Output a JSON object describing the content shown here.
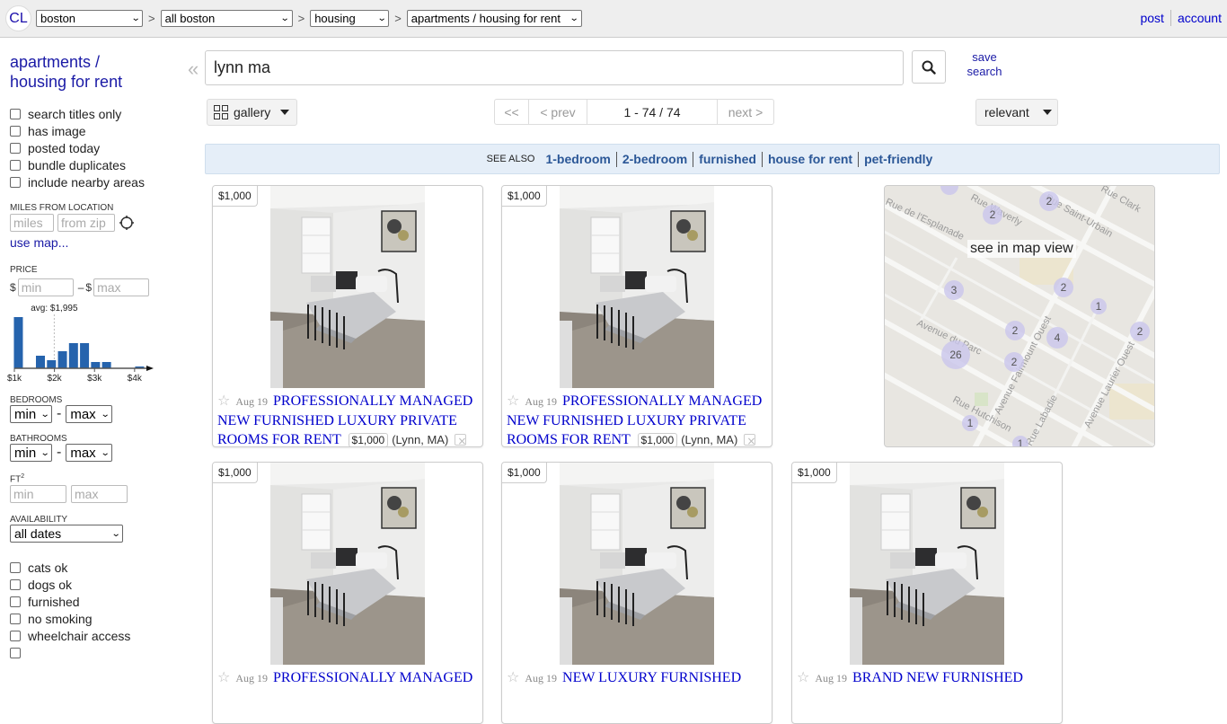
{
  "header": {
    "logo": "CL",
    "breadcrumbs": [
      {
        "label": "boston"
      },
      {
        "label": "all boston"
      },
      {
        "label": "housing"
      },
      {
        "label": "apartments / housing for rent"
      }
    ],
    "breadcrumb_separator": ">",
    "links": {
      "post": "post",
      "account": "account"
    }
  },
  "sidebar": {
    "title_line1": "apartments /",
    "title_line2": "housing for rent",
    "top_filters": [
      {
        "label": "search titles only",
        "checked": false
      },
      {
        "label": "has image",
        "checked": false
      },
      {
        "label": "posted today",
        "checked": false
      },
      {
        "label": "bundle duplicates",
        "checked": false
      },
      {
        "label": "include nearby areas",
        "checked": false
      }
    ],
    "miles": {
      "label": "MILES FROM LOCATION",
      "miles_placeholder": "miles",
      "zip_placeholder": "from zip",
      "use_map": "use map..."
    },
    "price": {
      "label": "PRICE",
      "currency": "$",
      "dash": "–",
      "min_placeholder": "min",
      "max_placeholder": "max",
      "avg_label": "avg: $1,995"
    },
    "bedrooms": {
      "label": "BEDROOMS",
      "min": "min",
      "max": "max",
      "dash": "-"
    },
    "bathrooms": {
      "label": "BATHROOMS",
      "min": "min",
      "max": "max",
      "dash": "-"
    },
    "sqft": {
      "label": "FT",
      "sup": "2",
      "min_placeholder": "min",
      "max_placeholder": "max"
    },
    "availability": {
      "label": "AVAILABILITY",
      "value": "all dates"
    },
    "bottom_filters": [
      {
        "label": "cats ok",
        "checked": false
      },
      {
        "label": "dogs ok",
        "checked": false
      },
      {
        "label": "furnished",
        "checked": false
      },
      {
        "label": "no smoking",
        "checked": false
      },
      {
        "label": "wheelchair access",
        "checked": false
      }
    ]
  },
  "chart_data": {
    "type": "bar",
    "title": "",
    "xlabel": "price",
    "ylabel": "",
    "tick_labels": [
      "$1k",
      "$2k",
      "$3k",
      "$4k"
    ],
    "tick_values": [
      1000,
      2000,
      3000,
      4000
    ],
    "xlim": [
      1000,
      4250
    ],
    "bins": [
      {
        "x": 1100,
        "count": 57
      },
      {
        "x": 1650,
        "count": 14
      },
      {
        "x": 1925,
        "count": 9
      },
      {
        "x": 2200,
        "count": 19
      },
      {
        "x": 2475,
        "count": 28
      },
      {
        "x": 2750,
        "count": 28
      },
      {
        "x": 3025,
        "count": 7
      },
      {
        "x": 3300,
        "count": 7
      },
      {
        "x": 4125,
        "count": 2
      }
    ],
    "average": 1995,
    "average_label": "avg: $1,995"
  },
  "search": {
    "query": "lynn ma",
    "collapse_glyph": "«",
    "save_line1": "save",
    "save_line2": "search"
  },
  "toolbar": {
    "view_label": "gallery",
    "pager": {
      "first": "<<",
      "prev": "< prev",
      "range": "1 - 74 / 74",
      "next": "next >"
    },
    "sort_label": "relevant"
  },
  "see_also": {
    "label": "SEE ALSO",
    "links": [
      "1-bedroom",
      "2-bedroom",
      "furnished",
      "house for rent",
      "pet-friendly"
    ]
  },
  "map": {
    "label": "see in map view",
    "streets": [
      "Rue de l'Esplanade",
      "Rue Waverly",
      "Rue Saint-Urbain",
      "Rue Clark",
      "Avenue du Parc",
      "Avenue Fairmount Ouest",
      "Avenue Laurier Ouest",
      "Rue Hutchison",
      "Rue Labadie"
    ],
    "clusters": [
      "2",
      "2",
      "3",
      "2",
      "1",
      "2",
      "4",
      "2",
      "26",
      "2",
      "1",
      "1"
    ]
  },
  "listings": [
    {
      "price": "$1,000",
      "date": "Aug 19",
      "title": "PROFESSIONALLY MANAGED NEW FURNISHED LUXURY PRIVATE ROOMS FOR RENT",
      "price_tag": "$1,000",
      "location": "(Lynn, MA)"
    },
    {
      "price": "$1,000",
      "date": "Aug 19",
      "title": "PROFESSIONALLY MANAGED NEW FURNISHED LUXURY PRIVATE ROOMS FOR RENT",
      "price_tag": "$1,000",
      "location": "(Lynn, MA)"
    },
    {
      "price": "$1,000",
      "date": "Aug 19",
      "title": "PROFESSIONALLY MANAGED"
    },
    {
      "price": "$1,000",
      "date": "Aug 19",
      "title": "NEW LUXURY FURNISHED"
    },
    {
      "price": "$1,000",
      "date": "Aug 19",
      "title": "BRAND NEW FURNISHED"
    }
  ]
}
